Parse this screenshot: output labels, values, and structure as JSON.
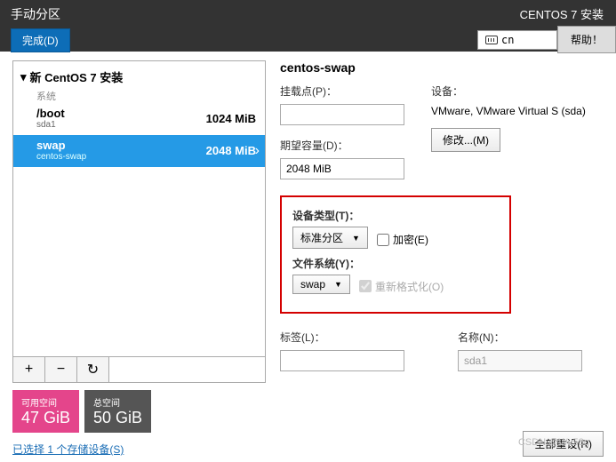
{
  "header": {
    "title": "手动分区",
    "done_label": "完成(D)",
    "install_title": "CENTOS 7 安装",
    "lang": "cn",
    "help_label": "帮助！"
  },
  "sidebar": {
    "group_title": "新 CentOS 7 安装",
    "system_label": "系统",
    "items": [
      {
        "name": "/boot",
        "dev": "sda1",
        "size": "1024 MiB"
      },
      {
        "name": "swap",
        "dev": "centos-swap",
        "size": "2048 MiB"
      }
    ],
    "toolbar": {
      "add": "+",
      "remove": "−",
      "refresh": "↻"
    },
    "avail_label": "可用空间",
    "avail_value": "47 GiB",
    "total_label": "总空间",
    "total_value": "50 GiB",
    "storage_link": "已选择 1 个存储设备(S)"
  },
  "detail": {
    "title": "centos-swap",
    "mount_label": "挂载点(P)：",
    "mount_value": "",
    "capacity_label": "期望容量(D)：",
    "capacity_value": "2048 MiB",
    "device_label": "设备：",
    "device_text": "VMware, VMware Virtual S (sda)",
    "modify_label": "修改...(M)",
    "type_label": "设备类型(T)：",
    "type_value": "标准分区",
    "encrypt_label": "加密(E)",
    "fs_label": "文件系统(Y)：",
    "fs_value": "swap",
    "reformat_label": "重新格式化(O)",
    "label_label": "标签(L)：",
    "label_value": "",
    "name_label": "名称(N)：",
    "name_value": "sda1",
    "reset_label": "全部重设(R)"
  },
  "watermark": "CSDN @Wu58g"
}
